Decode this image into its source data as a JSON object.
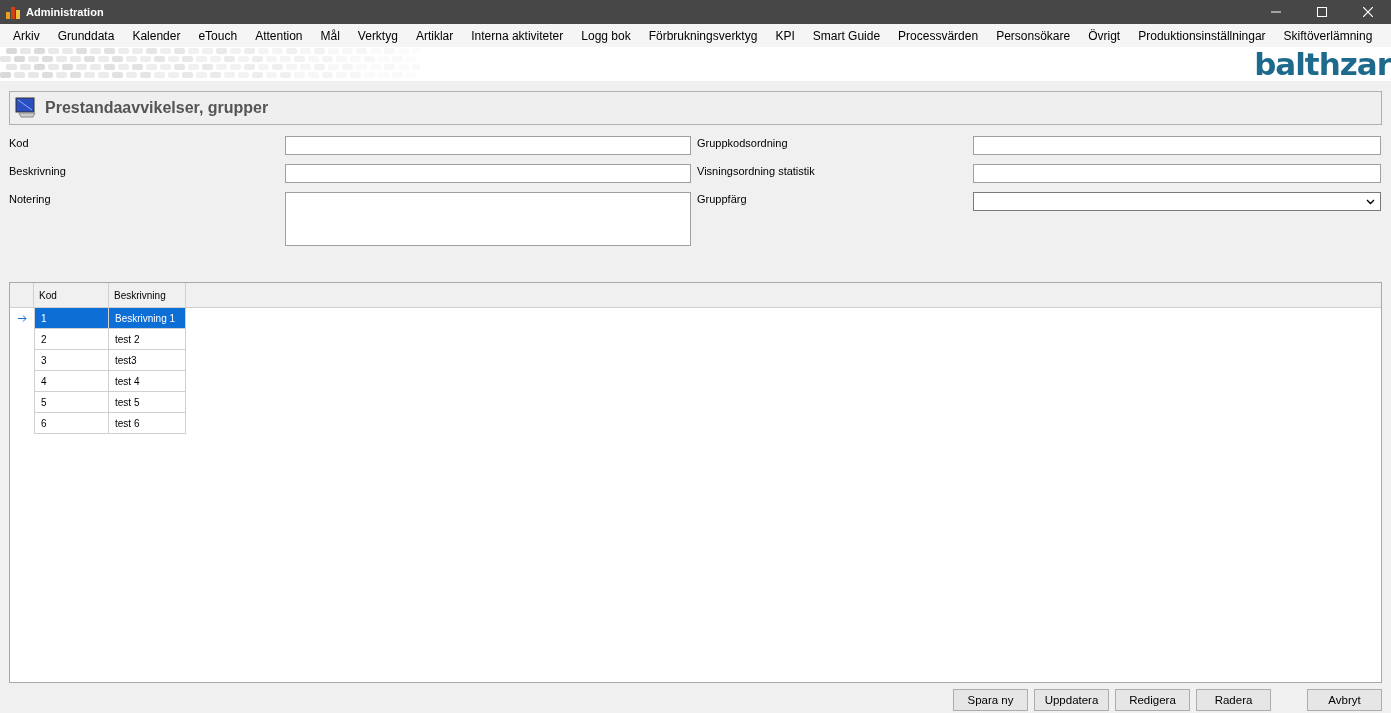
{
  "window": {
    "title": "Administration"
  },
  "menu": [
    "Arkiv",
    "Grunddata",
    "Kalender",
    "eTouch",
    "Attention",
    "Mål",
    "Verktyg",
    "Artiklar",
    "Interna aktiviteter",
    "Logg bok",
    "Förbrukningsverktyg",
    "KPI",
    "Smart Guide",
    "Processvärden",
    "Personsökare",
    "Övrigt",
    "Produktionsinställningar",
    "Skiftöverlämning"
  ],
  "logo": "balthzar",
  "panel": {
    "title": "Prestandaavvikelser, grupper"
  },
  "form": {
    "left": [
      {
        "label": "Kod",
        "kind": "text"
      },
      {
        "label": "Beskrivning",
        "kind": "text"
      },
      {
        "label": "Notering",
        "kind": "textarea"
      }
    ],
    "right": [
      {
        "label": "Gruppkodsordning",
        "kind": "text"
      },
      {
        "label": "Visningsordning statistik",
        "kind": "text"
      },
      {
        "label": "Gruppfärg",
        "kind": "select"
      }
    ]
  },
  "table": {
    "columns": [
      "Kod",
      "Beskrivning"
    ],
    "rows": [
      {
        "cells": [
          "1",
          "Beskrivning 1"
        ],
        "selected": true
      },
      {
        "cells": [
          "2",
          "test 2"
        ],
        "selected": false
      },
      {
        "cells": [
          "3",
          "test3"
        ],
        "selected": false
      },
      {
        "cells": [
          "4",
          "test 4"
        ],
        "selected": false
      },
      {
        "cells": [
          "5",
          "test 5"
        ],
        "selected": false
      },
      {
        "cells": [
          "6",
          "test 6"
        ],
        "selected": false
      }
    ]
  },
  "buttons": [
    "Spara ny",
    "Uppdatera",
    "Redigera",
    "Radera",
    "Avbryt"
  ]
}
